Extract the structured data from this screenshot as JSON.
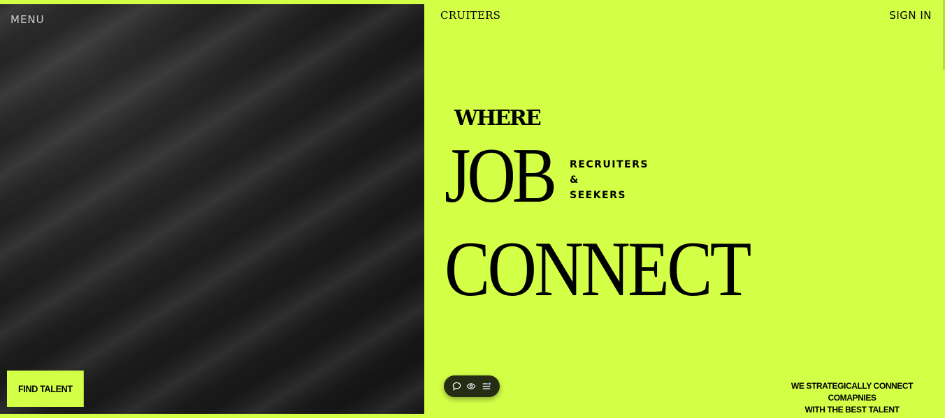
{
  "header": {
    "menu_label": "MENU",
    "brand": "CRUITERS",
    "sign_in_label": "SIGN IN"
  },
  "hero": {
    "where": "WHERE",
    "job": "JOB",
    "side_lines": [
      "RECRUITERS",
      "&",
      "SEEKERS"
    ],
    "connect": "CONNECT"
  },
  "cta": {
    "find_talent_label": "FIND TALENT"
  },
  "tagline": {
    "line1": "WE STRATEGICALLY CONNECT COMAPNIES",
    "line2": "WITH THE BEST TALENT"
  },
  "widget": {
    "icons": [
      "chat-icon",
      "eye-icon",
      "list-settings-icon"
    ]
  },
  "colors": {
    "accent": "#d4ff47",
    "dark_panel": "#1d1d1d",
    "text": "#000000",
    "widget_bg": "#262d14"
  }
}
